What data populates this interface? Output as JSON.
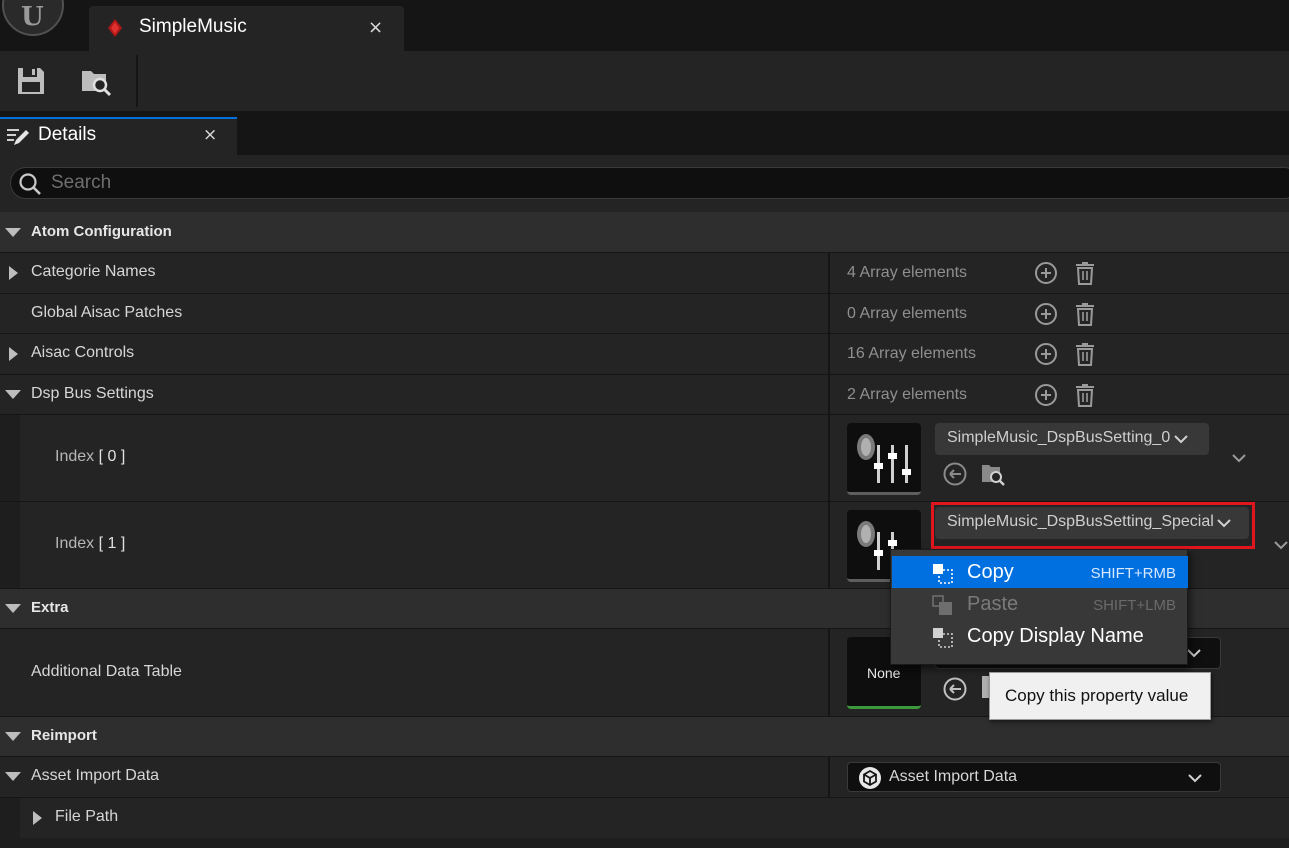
{
  "window": {
    "tab_title": "SimpleMusic",
    "tab_close": "×"
  },
  "toolbar": {
    "save_icon": "save-icon",
    "browse_icon": "browse-folder-icon"
  },
  "details_tab": {
    "label": "Details",
    "close": "×"
  },
  "search": {
    "placeholder": "Search",
    "value": ""
  },
  "sections": {
    "atom_configuration": "Atom Configuration",
    "extra": "Extra",
    "reimport": "Reimport"
  },
  "properties": {
    "categorie_names": {
      "label": "Categorie Names",
      "value": "4 Array elements"
    },
    "global_aisac_patches": {
      "label": "Global Aisac Patches",
      "value": "0 Array elements"
    },
    "aisac_controls": {
      "label": "Aisac Controls",
      "value": "16 Array elements"
    },
    "dsp_bus_settings": {
      "label": "Dsp Bus Settings",
      "value": "2 Array elements"
    },
    "index0": {
      "label_prefix": "Index",
      "label_index": "[ 0 ]",
      "asset": "SimpleMusic_DspBusSetting_0"
    },
    "index1": {
      "label_prefix": "Index",
      "label_index": "[ 1 ]",
      "asset": "SimpleMusic_DspBusSetting_Special"
    },
    "additional_data_table": {
      "label": "Additional Data Table",
      "thumb_text": "None"
    },
    "asset_import_data": {
      "label": "Asset Import Data",
      "value": "Asset Import Data"
    },
    "file_path": {
      "label": "File Path"
    }
  },
  "context_menu": {
    "items": [
      {
        "label": "Copy",
        "shortcut": "SHIFT+RMB",
        "state": "highlighted"
      },
      {
        "label": "Paste",
        "shortcut": "SHIFT+LMB",
        "state": "disabled"
      },
      {
        "label": "Copy Display Name",
        "shortcut": "",
        "state": "enabled"
      }
    ]
  },
  "tooltip": {
    "text": "Copy this property value"
  },
  "colors": {
    "accent": "#0070e0",
    "highlight_border": "#e0161e",
    "panel_bg": "#242424",
    "category_bg": "#2e2e2e"
  }
}
